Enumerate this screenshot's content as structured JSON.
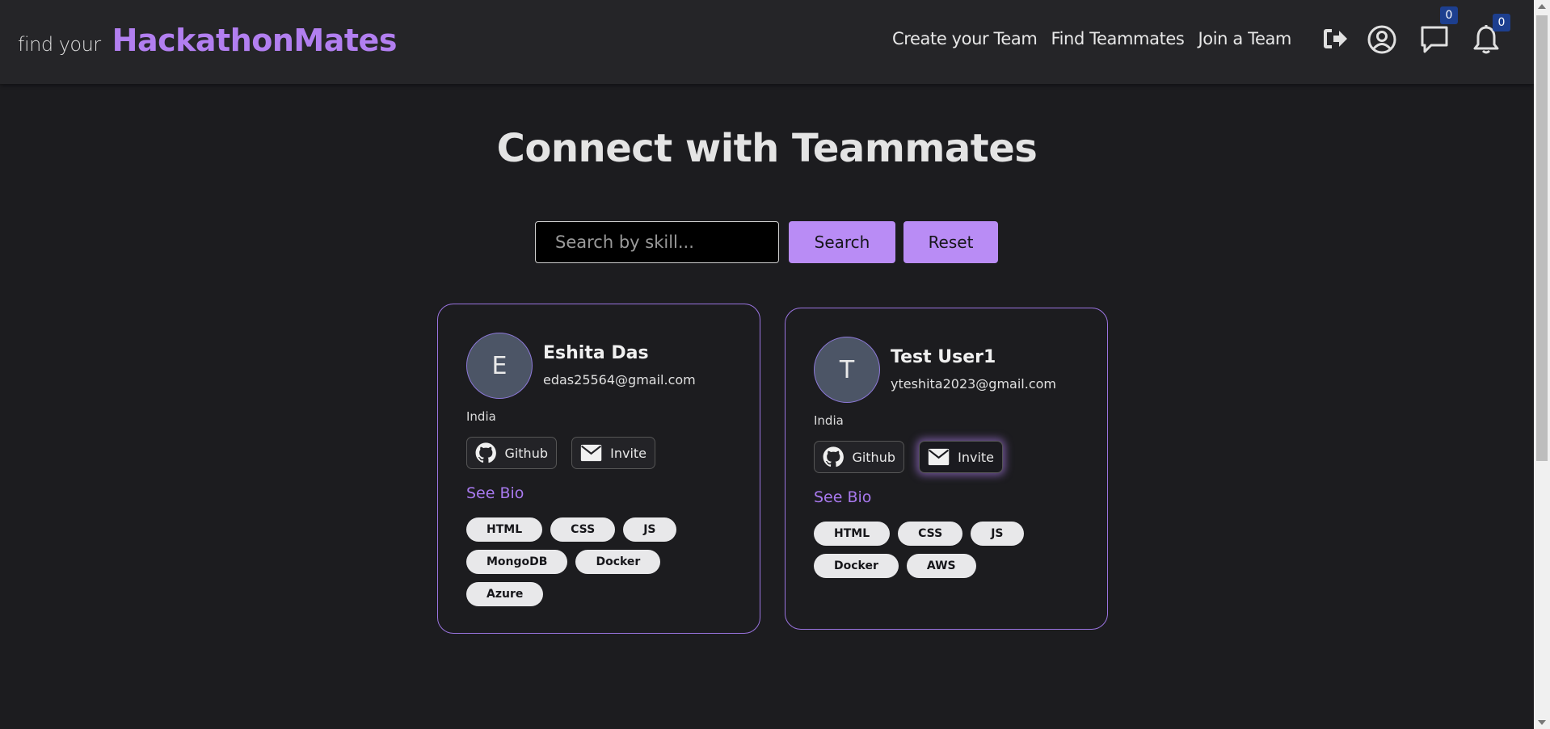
{
  "brand": {
    "prefix": "find your",
    "name": "HackathonMates",
    "accent_color": "#b27ff0"
  },
  "nav": {
    "links": [
      {
        "label": "Create your Team"
      },
      {
        "label": "Find Teammates"
      },
      {
        "label": "Join a Team"
      }
    ],
    "icons": {
      "logout": "logout-icon",
      "profile": "user-circle-icon",
      "messages": "chat-icon",
      "notifications": "bell-icon"
    },
    "messages_count": "0",
    "notifications_count": "0"
  },
  "page": {
    "title": "Connect with Teammates"
  },
  "search": {
    "placeholder": "Search by skill...",
    "value": "",
    "search_label": "Search",
    "reset_label": "Reset"
  },
  "users": [
    {
      "initial": "E",
      "name": "Eshita Das",
      "email": "edas25564@gmail.com",
      "country": "India",
      "github_label": "Github",
      "invite_label": "Invite",
      "bio_label": "See Bio",
      "skills": [
        "HTML",
        "CSS",
        "JS",
        "MongoDB",
        "Docker",
        "Azure"
      ]
    },
    {
      "initial": "T",
      "name": "Test User1",
      "email": "yteshita2023@gmail.com",
      "country": "India",
      "github_label": "Github",
      "invite_label": "Invite",
      "bio_label": "See Bio",
      "skills": [
        "HTML",
        "CSS",
        "JS",
        "Docker",
        "AWS"
      ]
    }
  ]
}
